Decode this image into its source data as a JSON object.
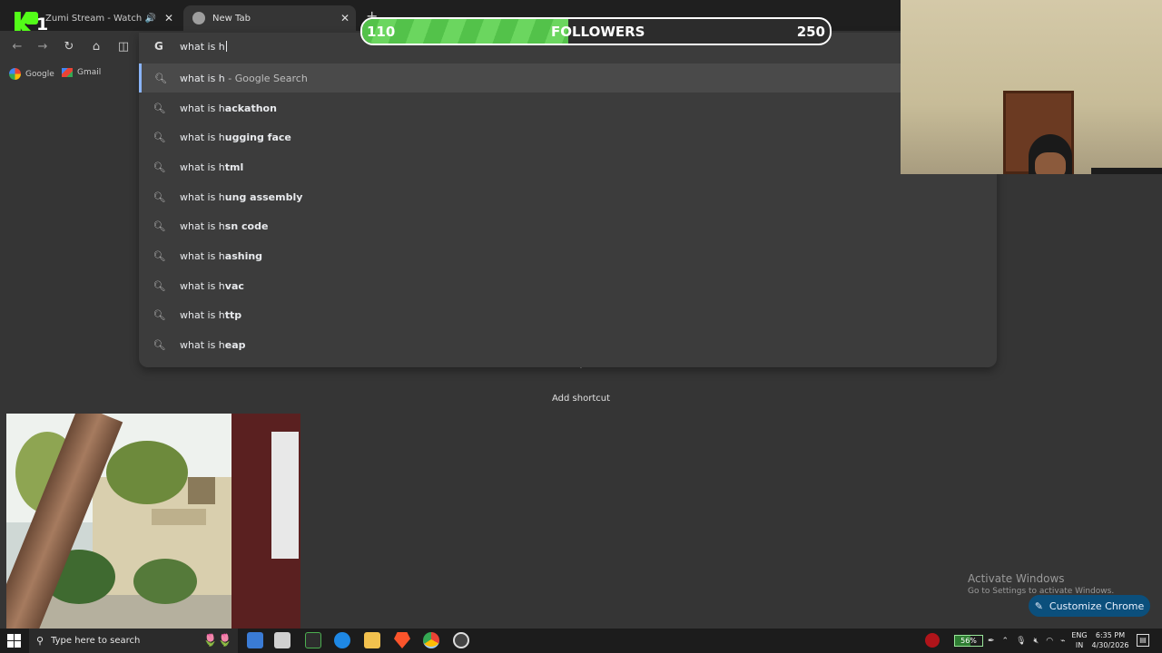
{
  "tabs": [
    {
      "title": "Zumi Stream - Watch Live on Kick",
      "favicon_color": "#53fc18"
    },
    {
      "title": "New Tab",
      "favicon_color": "#9e9e9e"
    }
  ],
  "kick_overlay": {
    "count": "1"
  },
  "followers_goal": {
    "current": "110",
    "label": "FOLLOWERS",
    "target": "250",
    "progress_fraction": 0.44
  },
  "omnibox": {
    "value": "what is h",
    "search_suffix": " - Google Search",
    "suggestions": [
      {
        "prefix": "what is h",
        "completion": "ackathon"
      },
      {
        "prefix": "what is h",
        "completion": "ugging face"
      },
      {
        "prefix": "what is h",
        "completion": "tml"
      },
      {
        "prefix": "what is h",
        "completion": "ung assembly"
      },
      {
        "prefix": "what is h",
        "completion": "sn code"
      },
      {
        "prefix": "what is h",
        "completion": "ashing"
      },
      {
        "prefix": "what is h",
        "completion": "vac"
      },
      {
        "prefix": "what is h",
        "completion": "ttp"
      },
      {
        "prefix": "what is h",
        "completion": "eap"
      }
    ]
  },
  "bookmarks": [
    {
      "label": "Google"
    },
    {
      "label": "Gmail"
    }
  ],
  "page": {
    "add_shortcut": "Add shortcut",
    "customize_button": "Customize Chrome"
  },
  "watermark": {
    "title": "Activate Windows",
    "subtitle": "Go to Settings to activate Windows."
  },
  "taskbar": {
    "search_placeholder": "Type here to search",
    "battery": "56%",
    "lang_line1": "ENG",
    "lang_line2": "IN",
    "time": "6:35 PM",
    "date": "4/30/2026"
  },
  "colors": {
    "accent_blue": "#8ab4f8",
    "kick_green": "#53fc18",
    "progress_green": "#53c24a",
    "customize_bg": "#0b4f7c"
  }
}
